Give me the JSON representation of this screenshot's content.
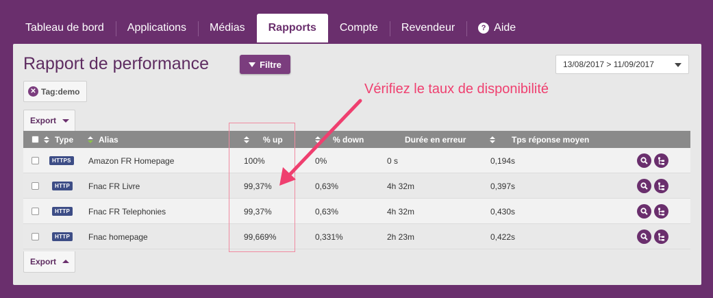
{
  "nav": {
    "items": [
      {
        "label": "Tableau de bord"
      },
      {
        "label": "Applications"
      },
      {
        "label": "Médias"
      },
      {
        "label": "Rapports"
      },
      {
        "label": "Compte"
      },
      {
        "label": "Revendeur"
      },
      {
        "label": "Aide"
      }
    ],
    "help_glyph": "?"
  },
  "page": {
    "title": "Rapport de performance",
    "filter_label": "Filtre",
    "date_range": "13/08/2017 > 11/09/2017",
    "tag_label": "Tag:demo",
    "export_label": "Export"
  },
  "table": {
    "headers": {
      "type": "Type",
      "alias": "Alias",
      "up": "% up",
      "down": "% down",
      "error": "Durée en erreur",
      "response": "Tps réponse moyen"
    },
    "rows": [
      {
        "type": "HTTPS",
        "alias": "Amazon FR Homepage",
        "up": "100%",
        "down": "0%",
        "error": "0 s",
        "response": "0,194s"
      },
      {
        "type": "HTTP",
        "alias": "Fnac FR Livre",
        "up": "99,37%",
        "down": "0,63%",
        "error": "4h 32m",
        "response": "0,397s"
      },
      {
        "type": "HTTP",
        "alias": "Fnac FR Telephonies",
        "up": "99,37%",
        "down": "0,63%",
        "error": "4h 32m",
        "response": "0,430s"
      },
      {
        "type": "HTTP",
        "alias": "Fnac homepage",
        "up": "99,669%",
        "down": "0,331%",
        "error": "2h 23m",
        "response": "0,422s"
      }
    ]
  },
  "annotation": {
    "text": "Vérifiez le taux de disponibilité"
  },
  "colors": {
    "brand": "#6a2f6d",
    "annotation": "#ef3f6f",
    "badge": "#3d4d86"
  }
}
